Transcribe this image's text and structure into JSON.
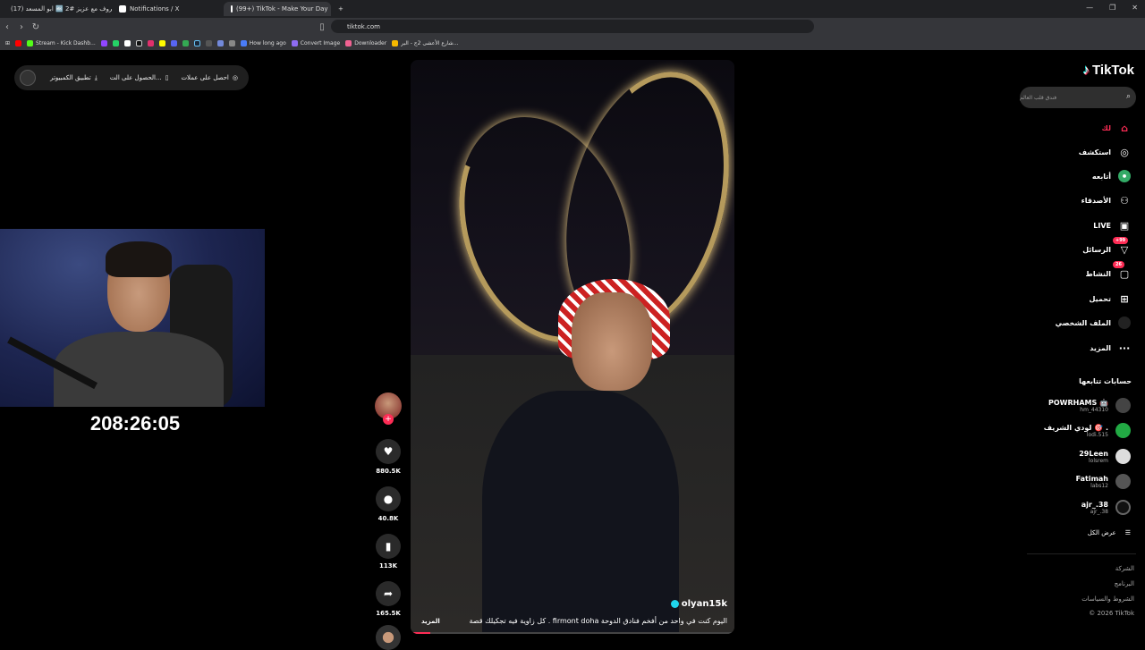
{
  "browser": {
    "tabs": [
      {
        "title": "(17) حروف مع عزيز #2 🔤 ابو المسعد",
        "color": "#ff0000",
        "active": false
      },
      {
        "title": "Notifications / X",
        "color": "#ffffff",
        "active": false
      },
      {
        "title": "(99+) TikTok - Make Your Day",
        "color": "#ffffff",
        "active": true
      }
    ],
    "new_tab": "+",
    "url": "tiktok.com",
    "bookmarks": [
      {
        "label": "",
        "color": "#ff0000"
      },
      {
        "label": "Stream - Kick Dashb...",
        "color": "#53fc18"
      },
      {
        "label": "",
        "color": "#9146ff"
      },
      {
        "label": "",
        "color": "#25d366"
      },
      {
        "label": "",
        "color": "#ffffff"
      },
      {
        "label": "How long ago",
        "color": "#4a7cf7"
      },
      {
        "label": "Convert Image",
        "color": "#8e6cf1"
      },
      {
        "label": "Downloader",
        "color": "#f06292"
      },
      {
        "label": "شارع الأعشى 2ج - البر...",
        "color": "#f5b800"
      }
    ]
  },
  "top_bar": {
    "coins": "احصل على عملات",
    "get_app": "الحصول على الت...",
    "desktop_app": "تطبيق الكمبيوتر"
  },
  "stream": {
    "timer": "208:26:05"
  },
  "video": {
    "username": "olyan15k",
    "caption": "اليوم كنت في واحد من أفخم فنادق الدوحة firmont doha . كل زاوية فيه تجكيلك قصة",
    "more_label": "المزيد",
    "progress": 0.06
  },
  "actions": {
    "follow_plus": "+",
    "likes": "880.5K",
    "comments": "40.8K",
    "saves": "113K",
    "shares": "165.5K"
  },
  "sidebar": {
    "logo": "TikTok",
    "search_placeholder": "فندق قلب العالم",
    "nav": [
      {
        "label": "لك",
        "icon": "home-icon",
        "accent": true
      },
      {
        "label": "استكشف",
        "icon": "compass-icon"
      },
      {
        "label": "أتابعه",
        "icon": "following-icon"
      },
      {
        "label": "الأصدقاء",
        "icon": "friends-icon"
      },
      {
        "label": "LIVE",
        "icon": "live-icon"
      },
      {
        "label": "الرسائل",
        "icon": "messages-icon",
        "badge": "+99"
      },
      {
        "label": "النشاط",
        "icon": "activity-icon",
        "badge": "26"
      },
      {
        "label": "تحميل",
        "icon": "upload-icon"
      },
      {
        "label": "الملف الشخصي",
        "icon": "profile-icon"
      },
      {
        "label": "المزيد",
        "icon": "more-icon"
      }
    ],
    "following_title": "حسابات تتابعها",
    "accounts": [
      {
        "name": "POWRHAMS 🤖",
        "handle": "hm_44310"
      },
      {
        "name": "لودي الشريف 🎯 .",
        "handle": "lodi.515"
      },
      {
        "name": "29Leen",
        "handle": "lolsrem"
      },
      {
        "name": "Fatimah",
        "handle": "labs12"
      },
      {
        "name": "ajr_.38",
        "handle": "ajr_.38"
      }
    ],
    "see_all": "عرض الكل",
    "footer": [
      "الشركة",
      "البرنامج",
      "الشروط والسياسات",
      "© 2026 TikTok"
    ]
  }
}
